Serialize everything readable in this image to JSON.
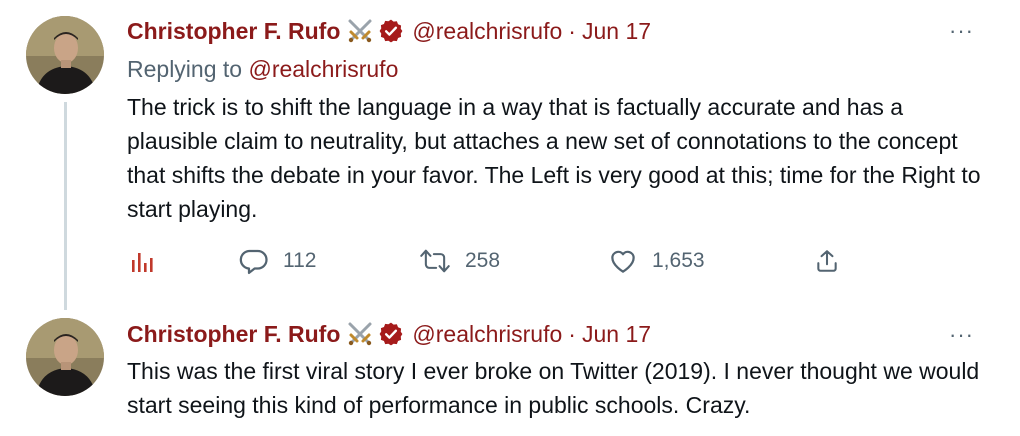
{
  "tweets": [
    {
      "name": "Christopher F. Rufo",
      "handle": "@realchrisrufo",
      "separator": "·",
      "date": "Jun 17",
      "more": "···",
      "replying_prefix": "Replying to ",
      "replying_handle": "@realchrisrufo",
      "text": "The trick is to shift the language in a way that is factually accurate and has a plausible claim to neutrality, but attaches a new set of connotations to the concept that shifts the debate in your favor. The Left is very good at this; time for the Right to start playing.",
      "actions": {
        "replies": "112",
        "retweets": "258",
        "likes": "1,653"
      },
      "icons": [
        "crossed-swords-icon",
        "verified-icon",
        "analytics-icon",
        "reply-icon",
        "retweet-icon",
        "like-icon",
        "share-icon"
      ]
    },
    {
      "name": "Christopher F. Rufo",
      "handle": "@realchrisrufo",
      "separator": "·",
      "date": "Jun 17",
      "more": "···",
      "text": "This was the first viral story I ever broke on Twitter (2019). I never thought we would start seeing this kind of performance in public schools. Crazy."
    }
  ],
  "colors": {
    "name": "#8b1a1a",
    "secondary_text": "#536471",
    "analytics_icon": "#c0392b",
    "thread_line": "#cfd9de"
  }
}
